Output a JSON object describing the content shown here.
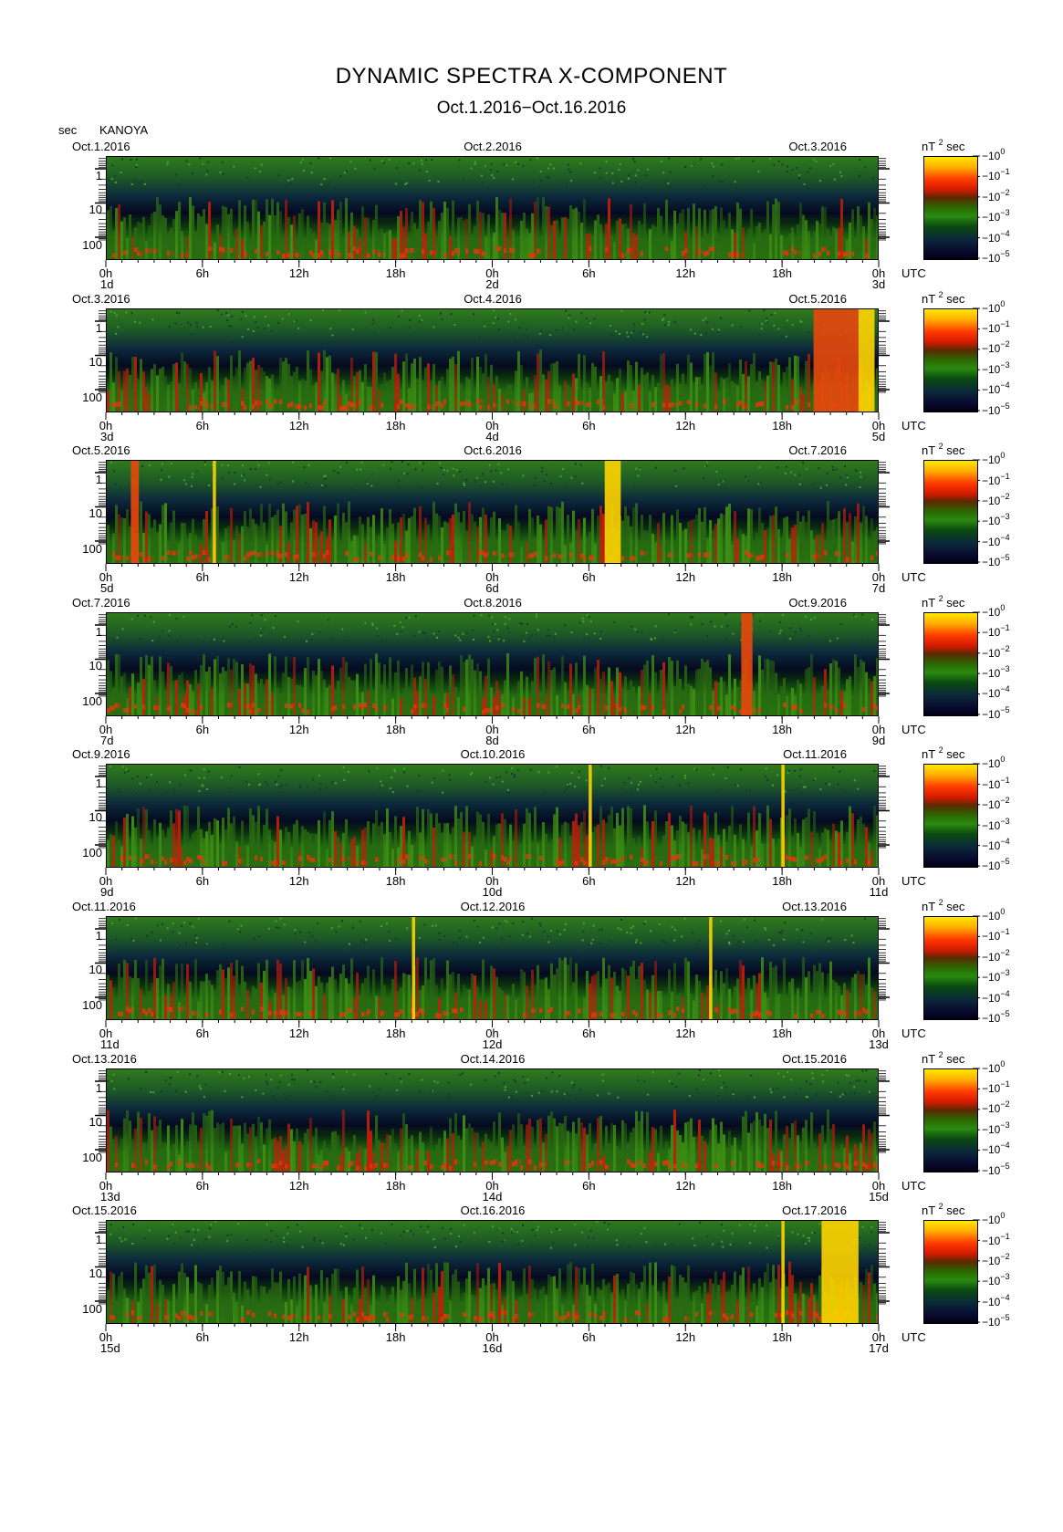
{
  "header": {
    "title": "DYNAMIC SPECTRA X-COMPONENT",
    "subtitle": "Oct.1.2016−Oct.16.2016",
    "unit_label": "sec",
    "station": "KANOYA"
  },
  "axis": {
    "y_ticks": [
      "1",
      "10",
      "100"
    ],
    "x_ticks": [
      "0h",
      "6h",
      "12h",
      "18h",
      "0h",
      "6h",
      "12h",
      "18h",
      "0h"
    ],
    "x_unit": "UTC",
    "colorbar_unit": "nT",
    "colorbar_unit_sup": "2",
    "colorbar_unit_suffix": "sec",
    "colorbar_base": "−10",
    "colorbar_exponents": [
      "0",
      "−1",
      "−2",
      "−3",
      "−4",
      "−5"
    ]
  },
  "panels": [
    {
      "date_left": "Oct.1.2016",
      "date_mid": "Oct.2.2016",
      "date_right": "Oct.3.2016",
      "day_left": "1d",
      "day_mid": "2d",
      "day_right": "3d"
    },
    {
      "date_left": "Oct.3.2016",
      "date_mid": "Oct.4.2016",
      "date_right": "Oct.5.2016",
      "day_left": "3d",
      "day_mid": "4d",
      "day_right": "5d"
    },
    {
      "date_left": "Oct.5.2016",
      "date_mid": "Oct.6.2016",
      "date_right": "Oct.7.2016",
      "day_left": "5d",
      "day_mid": "6d",
      "day_right": "7d"
    },
    {
      "date_left": "Oct.7.2016",
      "date_mid": "Oct.8.2016",
      "date_right": "Oct.9.2016",
      "day_left": "7d",
      "day_mid": "8d",
      "day_right": "9d"
    },
    {
      "date_left": "Oct.9.2016",
      "date_mid": "Oct.10.2016",
      "date_right": "Oct.11.2016",
      "day_left": "9d",
      "day_mid": "10d",
      "day_right": "11d"
    },
    {
      "date_left": "Oct.11.2016",
      "date_mid": "Oct.12.2016",
      "date_right": "Oct.13.2016",
      "day_left": "11d",
      "day_mid": "12d",
      "day_right": "13d"
    },
    {
      "date_left": "Oct.13.2016",
      "date_mid": "Oct.14.2016",
      "date_right": "Oct.15.2016",
      "day_left": "13d",
      "day_mid": "14d",
      "day_right": "15d"
    },
    {
      "date_left": "Oct.15.2016",
      "date_mid": "Oct.16.2016",
      "date_right": "Oct.17.2016",
      "day_left": "15d",
      "day_mid": "16d",
      "day_right": "17d"
    }
  ],
  "chart_data": {
    "type": "heatmap",
    "title": "DYNAMIC SPECTRA X-COMPONENT",
    "subtitle": "Oct.1.2016−Oct.16.2016",
    "xlabel": "UTC",
    "ylabel": "sec",
    "y_scale": "log",
    "y_ticks": [
      1,
      10,
      100
    ],
    "y_inverted": true,
    "x_ticks_hours": [
      "0h",
      "6h",
      "12h",
      "18h",
      "0h",
      "6h",
      "12h",
      "18h",
      "0h"
    ],
    "panel_span_days": 2,
    "colorscale": {
      "unit": "nT^2 sec",
      "range": [
        "10^0",
        "10^-5"
      ],
      "colors": [
        "#ffe800",
        "#ff3a00",
        "#d41a00",
        "#2a8a10",
        "#0a2a3a",
        "#000010"
      ]
    },
    "bursts": [
      {
        "panel": 1,
        "start_h": 44.0,
        "end_h": 46.8,
        "intensity": 0.7
      },
      {
        "panel": 1,
        "start_h": 46.8,
        "end_h": 47.8,
        "intensity": 1.0
      },
      {
        "panel": 2,
        "start_h": 1.5,
        "end_h": 2.0,
        "intensity": 0.8
      },
      {
        "panel": 2,
        "start_h": 6.6,
        "end_h": 6.8,
        "intensity": 1.0
      },
      {
        "panel": 2,
        "start_h": 31.0,
        "end_h": 32.0,
        "intensity": 1.0
      },
      {
        "panel": 3,
        "start_h": 39.5,
        "end_h": 40.2,
        "intensity": 0.8
      },
      {
        "panel": 4,
        "start_h": 30.0,
        "end_h": 30.2,
        "intensity": 1.0
      },
      {
        "panel": 4,
        "start_h": 42.0,
        "end_h": 42.2,
        "intensity": 1.0
      },
      {
        "panel": 5,
        "start_h": 19.0,
        "end_h": 19.2,
        "intensity": 1.0
      },
      {
        "panel": 5,
        "start_h": 37.5,
        "end_h": 37.7,
        "intensity": 1.0
      },
      {
        "panel": 7,
        "start_h": 42.0,
        "end_h": 42.2,
        "intensity": 1.0
      },
      {
        "panel": 7,
        "start_h": 44.5,
        "end_h": 46.8,
        "intensity": 1.0
      }
    ]
  }
}
